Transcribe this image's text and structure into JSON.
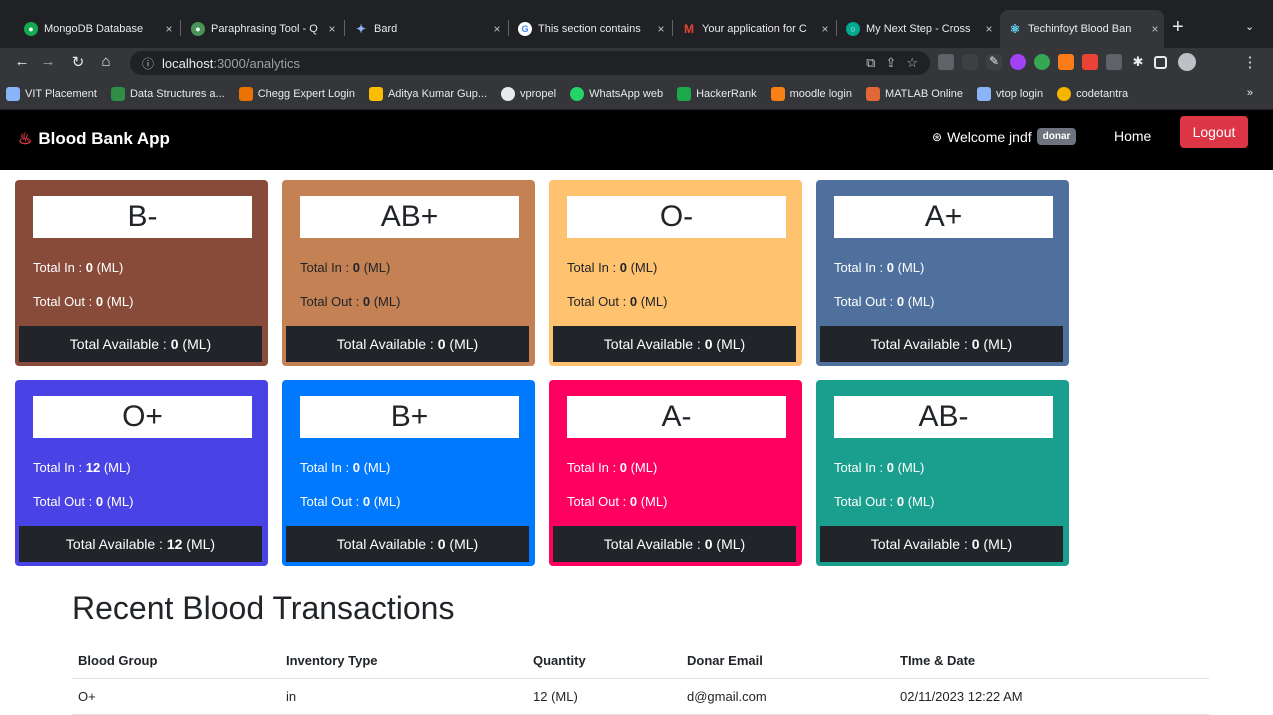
{
  "browser": {
    "tabs": [
      {
        "title": "MongoDB Database",
        "color": "#13aa52",
        "close": "×"
      },
      {
        "title": "Paraphrasing Tool - Q",
        "color": "#499557",
        "close": "×"
      },
      {
        "title": "Bard",
        "color": "#4285f4",
        "close": "×"
      },
      {
        "title": "This section contains",
        "color": "#4285f4",
        "close": "×"
      },
      {
        "title": "Your application for C",
        "color": "#ea4335",
        "close": "×"
      },
      {
        "title": "My Next Step - Cross",
        "color": "#00a98f",
        "close": "×"
      },
      {
        "title": "Techinfoyt Blood Ban",
        "color": "#61dafb",
        "close": "×"
      }
    ],
    "new_tab": "+",
    "tab_menu": "⌄",
    "url_host": "localhost",
    "url_path": ":3000/analytics",
    "bookmarks": [
      {
        "label": "VIT Placement",
        "color": "#8ab4f8"
      },
      {
        "label": "Data Structures a...",
        "color": "#2f8d46"
      },
      {
        "label": "Chegg Expert Login",
        "color": "#eb7100"
      },
      {
        "label": "Aditya Kumar Gup...",
        "color": "#fbbc04"
      },
      {
        "label": "vpropel",
        "color": "#e8eaed"
      },
      {
        "label": "WhatsApp web",
        "color": "#25d366"
      },
      {
        "label": "HackerRank",
        "color": "#1ba94c"
      },
      {
        "label": "moodle login",
        "color": "#f98012"
      },
      {
        "label": "MATLAB Online",
        "color": "#e16737"
      },
      {
        "label": "vtop login",
        "color": "#8ab4f8"
      },
      {
        "label": "codetantra",
        "color": "#f4b400"
      }
    ],
    "bookmarks_more": "»"
  },
  "navbar": {
    "brand": "Blood Bank App",
    "welcome": "Welcome jndf",
    "role_badge": "donar",
    "home": "Home",
    "logout": "Logout"
  },
  "cards": [
    {
      "group": "B-",
      "total_in": "0",
      "total_out": "0",
      "available": "0",
      "bg": "#884a39",
      "text": "#ffffff"
    },
    {
      "group": "AB+",
      "total_in": "0",
      "total_out": "0",
      "available": "0",
      "bg": "#c38154",
      "text": "#212529"
    },
    {
      "group": "O-",
      "total_in": "0",
      "total_out": "0",
      "available": "0",
      "bg": "#ffc26f",
      "text": "#212529"
    },
    {
      "group": "A+",
      "total_in": "0",
      "total_out": "0",
      "available": "0",
      "bg": "#4f709c",
      "text": "#ffffff"
    },
    {
      "group": "O+",
      "total_in": "12",
      "total_out": "0",
      "available": "12",
      "bg": "#4942e4",
      "text": "#ffffff"
    },
    {
      "group": "B+",
      "total_in": "0",
      "total_out": "0",
      "available": "0",
      "bg": "#0079ff",
      "text": "#ffffff"
    },
    {
      "group": "A-",
      "total_in": "0",
      "total_out": "0",
      "available": "0",
      "bg": "#ff0060",
      "text": "#ffffff"
    },
    {
      "group": "AB-",
      "total_in": "0",
      "total_out": "0",
      "available": "0",
      "bg": "#1a9f8e",
      "text": "#ffffff"
    }
  ],
  "labels": {
    "total_in": "Total In : ",
    "total_out": "Total Out : ",
    "available": "Total Available : ",
    "unit": " (ML)"
  },
  "transactions": {
    "title": "Recent Blood Transactions",
    "headers": [
      "Blood Group",
      "Inventory Type",
      "Quantity",
      "Donar Email",
      "TIme & Date"
    ],
    "rows": [
      [
        "O+",
        "in",
        "12 (ML)",
        "d@gmail.com",
        "02/11/2023 12:22 AM"
      ]
    ]
  }
}
